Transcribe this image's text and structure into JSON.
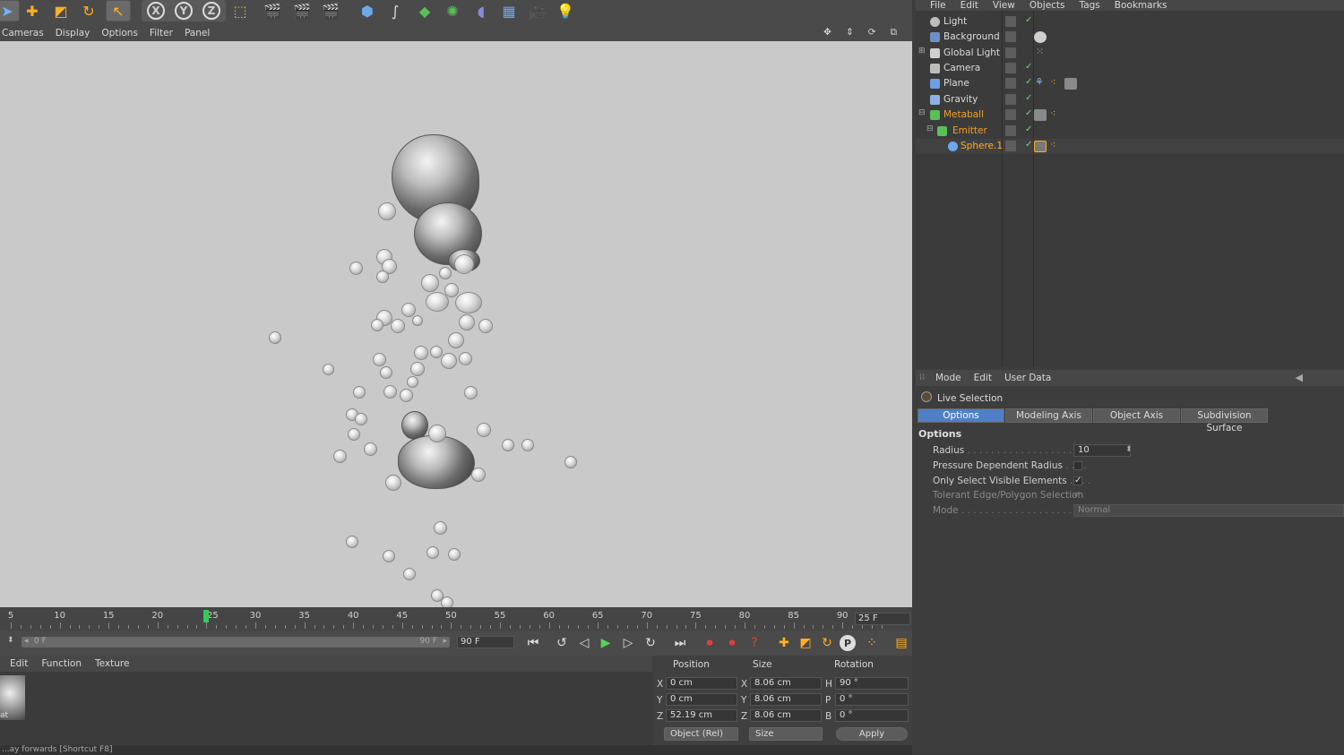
{
  "toolbar": {
    "icons": [
      "live-selection-icon",
      "move-icon",
      "scale-icon",
      "rotate-icon",
      "select-icon",
      "x-axis-icon",
      "y-axis-icon",
      "z-axis-icon",
      "coordinate-system-icon",
      "render-view-icon",
      "render-picture-icon",
      "edit-render-settings-icon",
      "cube-icon",
      "spline-icon",
      "nurbs-icon",
      "mograph-icon",
      "deformer-icon",
      "scene-icon",
      "camera-icon",
      "light-icon"
    ],
    "x_label": "X",
    "y_label": "Y",
    "z_label": "Z"
  },
  "viewport": {
    "menu": [
      "Cameras",
      "Display",
      "Options",
      "Filter",
      "Panel"
    ]
  },
  "timeline": {
    "ticks": [
      "5",
      "10",
      "15",
      "20",
      "25",
      "30",
      "35",
      "40",
      "45",
      "50",
      "55",
      "60",
      "65",
      "70",
      "75",
      "80",
      "85",
      "90"
    ],
    "current_frame": "25 F",
    "range_start": "0 F",
    "range_end": "90 F",
    "end_frame": "90 F"
  },
  "material_manager": {
    "menu": [
      "Edit",
      "Function",
      "Texture"
    ],
    "material_name": "at"
  },
  "coordinates": {
    "headers": {
      "position": "Position",
      "size": "Size",
      "rotation": "Rotation"
    },
    "rows": [
      {
        "axis": "X",
        "pos": "0 cm",
        "size_axis": "X",
        "size": "8.06 cm",
        "rot_axis": "H",
        "rot": "90 °"
      },
      {
        "axis": "Y",
        "pos": "0 cm",
        "size_axis": "Y",
        "size": "8.06 cm",
        "rot_axis": "P",
        "rot": "0 °"
      },
      {
        "axis": "Z",
        "pos": "52.19 cm",
        "size_axis": "Z",
        "size": "8.06 cm",
        "rot_axis": "B",
        "rot": "0 °"
      }
    ],
    "mode_select": "Object (Rel)",
    "size_select": "Size",
    "apply_label": "Apply"
  },
  "status_bar": "...ay forwards [Shortcut F8]",
  "object_manager": {
    "menu": [
      "File",
      "Edit",
      "View",
      "Objects",
      "Tags",
      "Bookmarks"
    ],
    "objects": [
      {
        "name": "Light",
        "state": "normal",
        "indent": 0,
        "icon_color": "#bdbdbd"
      },
      {
        "name": "Background",
        "state": "normal",
        "indent": 0,
        "icon_color": "#6f8fc8"
      },
      {
        "name": "Global Light",
        "state": "normal",
        "indent": 0,
        "icon_color": "#cfcfcf"
      },
      {
        "name": "Camera",
        "state": "normal",
        "indent": 0,
        "icon_color": "#bdbdbd"
      },
      {
        "name": "Plane",
        "state": "normal",
        "indent": 0,
        "icon_color": "#6f9fe0"
      },
      {
        "name": "Gravity",
        "state": "normal",
        "indent": 0,
        "icon_color": "#8fb0e0"
      },
      {
        "name": "Metaball",
        "state": "selected",
        "indent": 0,
        "icon_color": "#58c058"
      },
      {
        "name": "Emitter",
        "state": "selected",
        "indent": 1,
        "icon_color": "#58c058"
      },
      {
        "name": "Sphere.1",
        "state": "active",
        "indent": 2,
        "icon_color": "#6fa8e8"
      }
    ]
  },
  "attribute_manager": {
    "menu": [
      "Mode",
      "Edit",
      "User Data"
    ],
    "tool_title": "Live Selection",
    "tabs": [
      "Options",
      "Modeling Axis",
      "Object Axis",
      "Subdivision Surface"
    ],
    "section": "Options",
    "radius_label": "Radius",
    "radius_value": "10",
    "pressure_label": "Pressure Dependent Radius",
    "visible_label": "Only Select Visible Elements",
    "tolerant_label": "Tolerant Edge/Polygon Selection",
    "mode_label": "Mode",
    "mode_value": "Normal",
    "check_mark": "✓"
  },
  "colors": {
    "accent_blue": "#4f7fc6",
    "selected_orange": "#f0a030",
    "playhead_green": "#37c957"
  }
}
